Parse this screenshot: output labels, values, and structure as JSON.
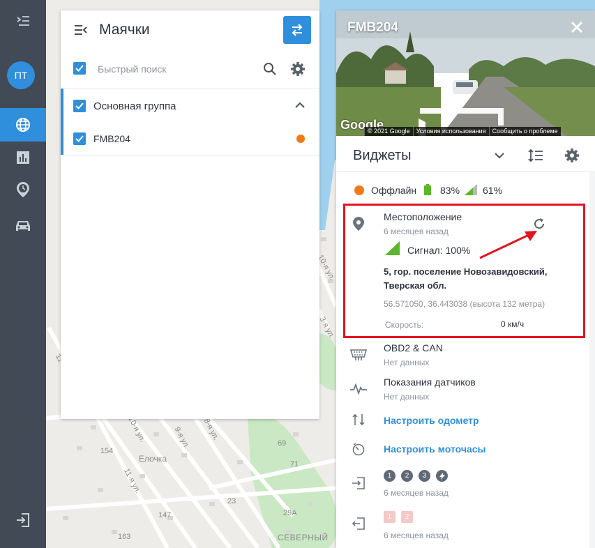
{
  "sidebar": {
    "avatar_initials": "ПТ",
    "items": [
      "menu-toggle",
      "globe",
      "reports",
      "history",
      "vehicles",
      "logout"
    ]
  },
  "trackers_panel": {
    "title": "Маячки",
    "search_placeholder": "Быстрый поиск",
    "group_label": "Основная группа",
    "device_label": "FMB204",
    "device_status_color": "#f07b16"
  },
  "details_panel": {
    "device_title": "FMB204",
    "streetview_logo": "Google",
    "streetview_footer": [
      "© 2021 Google",
      "Условия использования",
      "Сообщить о проблеме"
    ],
    "widgets_title": "Виджеты",
    "status": {
      "label": "Оффлайн",
      "battery": "83%",
      "signal": "61%"
    },
    "location": {
      "title": "Местоположение",
      "time": "6 месяцев назад",
      "signal_label": "Сигнал: 100%",
      "address_line1": "5, гор. поселение Новозавидовский,",
      "address_line2": "Тверская обл.",
      "coords": "56.571050, 36.443038 (высота 132 метра)",
      "speed_label": "Скорость:",
      "speed_value": "0 км/ч"
    },
    "obd": {
      "title": "OBD2 & CAN",
      "value": "Нет данных"
    },
    "sensors": {
      "title": "Показания датчиков",
      "value": "Нет данных"
    },
    "odometer_link": "Настроить одометр",
    "engine_hours_link": "Настроить моточасы",
    "inputs": {
      "badges": [
        "1",
        "2",
        "3"
      ],
      "time": "6 месяцев назад"
    },
    "outputs": {
      "badges": [
        "1",
        "2"
      ],
      "time": "6 месяцев назад"
    }
  },
  "map": {
    "labels": [
      "154",
      "Елочка",
      "147",
      "163",
      "23",
      "29А",
      "69",
      "71",
      "СЕВЕРНЫЙ",
      "11-я ул.",
      "10-я ул.",
      "9-я ул.",
      "8-я ул.",
      "11-я ул.",
      "3-я ул.",
      "10-я ул."
    ]
  },
  "colors": {
    "accent": "#2f8fdc",
    "offline": "#f07b16",
    "highlight": "#e3141f",
    "sidebar": "#414a55"
  }
}
